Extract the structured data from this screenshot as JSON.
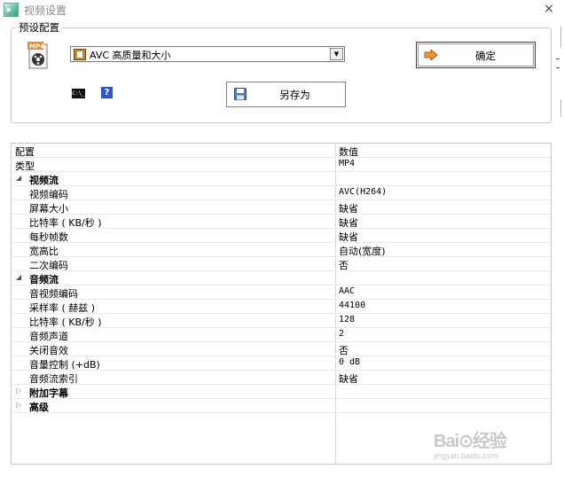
{
  "window": {
    "title": "视频设置",
    "close_glyph": "×"
  },
  "preset": {
    "group_label": "预设配置",
    "icon": "mp4-file-icon",
    "icon_text": "MP4",
    "selected": "AVC 高质量和大小",
    "ok_label": "确定",
    "save_as_label": "另存为"
  },
  "grid": {
    "col_key": "配置",
    "col_value": "数值",
    "rows": [
      {
        "key": "类型",
        "value": "MP4"
      },
      {
        "cat": "视频流",
        "expanded": true
      },
      {
        "key": "视频编码",
        "value": "AVC(H264)"
      },
      {
        "key": "屏幕大小",
        "value": "缺省"
      },
      {
        "key": "比特率 ( KB/秒 )",
        "value": "缺省"
      },
      {
        "key": "每秒帧数",
        "value": "缺省"
      },
      {
        "key": "宽高比",
        "value": "自动(宽度)"
      },
      {
        "key": "二次编码",
        "value": "否"
      },
      {
        "cat": "音频流",
        "expanded": true
      },
      {
        "key": "音视频编码",
        "value": "AAC"
      },
      {
        "key": "采样率 ( 赫兹 )",
        "value": "44100"
      },
      {
        "key": "比特率 ( KB/秒 )",
        "value": "128"
      },
      {
        "key": "音频声道",
        "value": "2"
      },
      {
        "key": "关闭音效",
        "value": "否"
      },
      {
        "key": "音量控制 (+dB)",
        "value": "0 dB"
      },
      {
        "key": "音频流索引",
        "value": "缺省"
      },
      {
        "cat": "附加字幕",
        "expanded": false
      },
      {
        "cat": "高级",
        "expanded": false
      }
    ]
  },
  "watermark": {
    "logo": "Bai⊙经验",
    "url": "jingyan.baidu.com"
  },
  "colors": {
    "accent_arrow": "#e8781a",
    "help_icon": "#2b55c8"
  }
}
